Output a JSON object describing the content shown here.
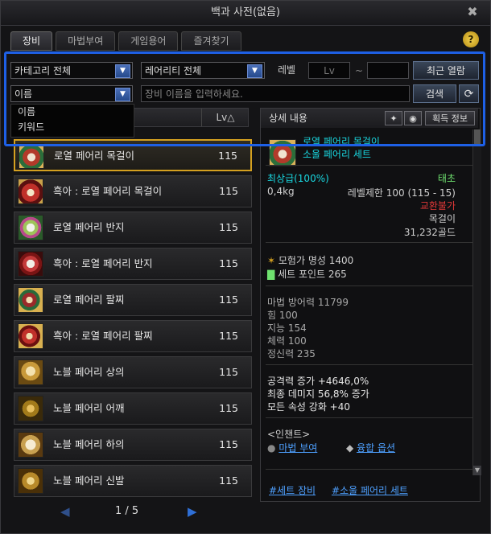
{
  "window": {
    "title": "백과 사전(없음)"
  },
  "tabs": [
    {
      "label": "장비",
      "active": true
    },
    {
      "label": "마법부여"
    },
    {
      "label": "게임용어"
    },
    {
      "label": "즐겨찾기"
    }
  ],
  "filters": {
    "category": "카테고리 전체",
    "rarity": "레어리티 전체",
    "level_label": "레벨",
    "level_from_placeholder": "Lv",
    "level_sep": "~",
    "recent_button": "최근 열람",
    "search_type": "이름",
    "search_placeholder": "장비 이름을 입력하세요.",
    "search_button": "검색"
  },
  "search_type_options": [
    "이름",
    "키워드"
  ],
  "list": {
    "level_header": "Lv△",
    "items": [
      {
        "name": "로열 페어리 목걸이",
        "level": "115"
      },
      {
        "name": "흑아 : 로열 페어리 목걸이",
        "level": "115"
      },
      {
        "name": "로열 페어리 반지",
        "level": "115"
      },
      {
        "name": "흑아 : 로열 페어리 반지",
        "level": "115"
      },
      {
        "name": "로열 페어리 팔찌",
        "level": "115"
      },
      {
        "name": "흑아 : 로열 페어리 팔찌",
        "level": "115"
      },
      {
        "name": "노블 페어리 상의",
        "level": "115"
      },
      {
        "name": "노블 페어리 어깨",
        "level": "115"
      },
      {
        "name": "노블 페어리 하의",
        "level": "115"
      },
      {
        "name": "노블 페어리 신발",
        "level": "115"
      }
    ],
    "page": "1 / 5"
  },
  "detail": {
    "header": "상세 내용",
    "acquire_button": "획득 정보",
    "item_name": "로열 페어리 목걸이",
    "set_name": "소울 페어리 세트",
    "grade": "최상급(100%)",
    "seal": "태초",
    "weight": "0,4kg",
    "level_limit": "레벨제한 100 (115 - 15)",
    "trade": "교환불가",
    "type": "목걸이",
    "price": "31,232골드",
    "fame": "모험가 명성 1400",
    "set_point": "세트 포인트 265",
    "stats": [
      "마법 방어력 11799",
      "힘 100",
      "지능 154",
      "체력 100",
      "정신력 235"
    ],
    "effects": [
      "공격력 증가 +4646,0%",
      "최종 데미지 56,8% 증가",
      "모든 속성 강화 +40"
    ],
    "enchant_title": "<인챈트>",
    "enchant_link": "마법 부여",
    "fusion_link": "융합 옵션",
    "tags": [
      "#세트 장비",
      "#소울 페어리 세트"
    ]
  },
  "colors": {
    "highlight": "#1e60e6",
    "selected_border": "#d4a020",
    "cyan": "#19d7e0",
    "orange": "#f0a040",
    "red": "#e03838",
    "green": "#6fe26f",
    "link": "#4ea0ff"
  }
}
